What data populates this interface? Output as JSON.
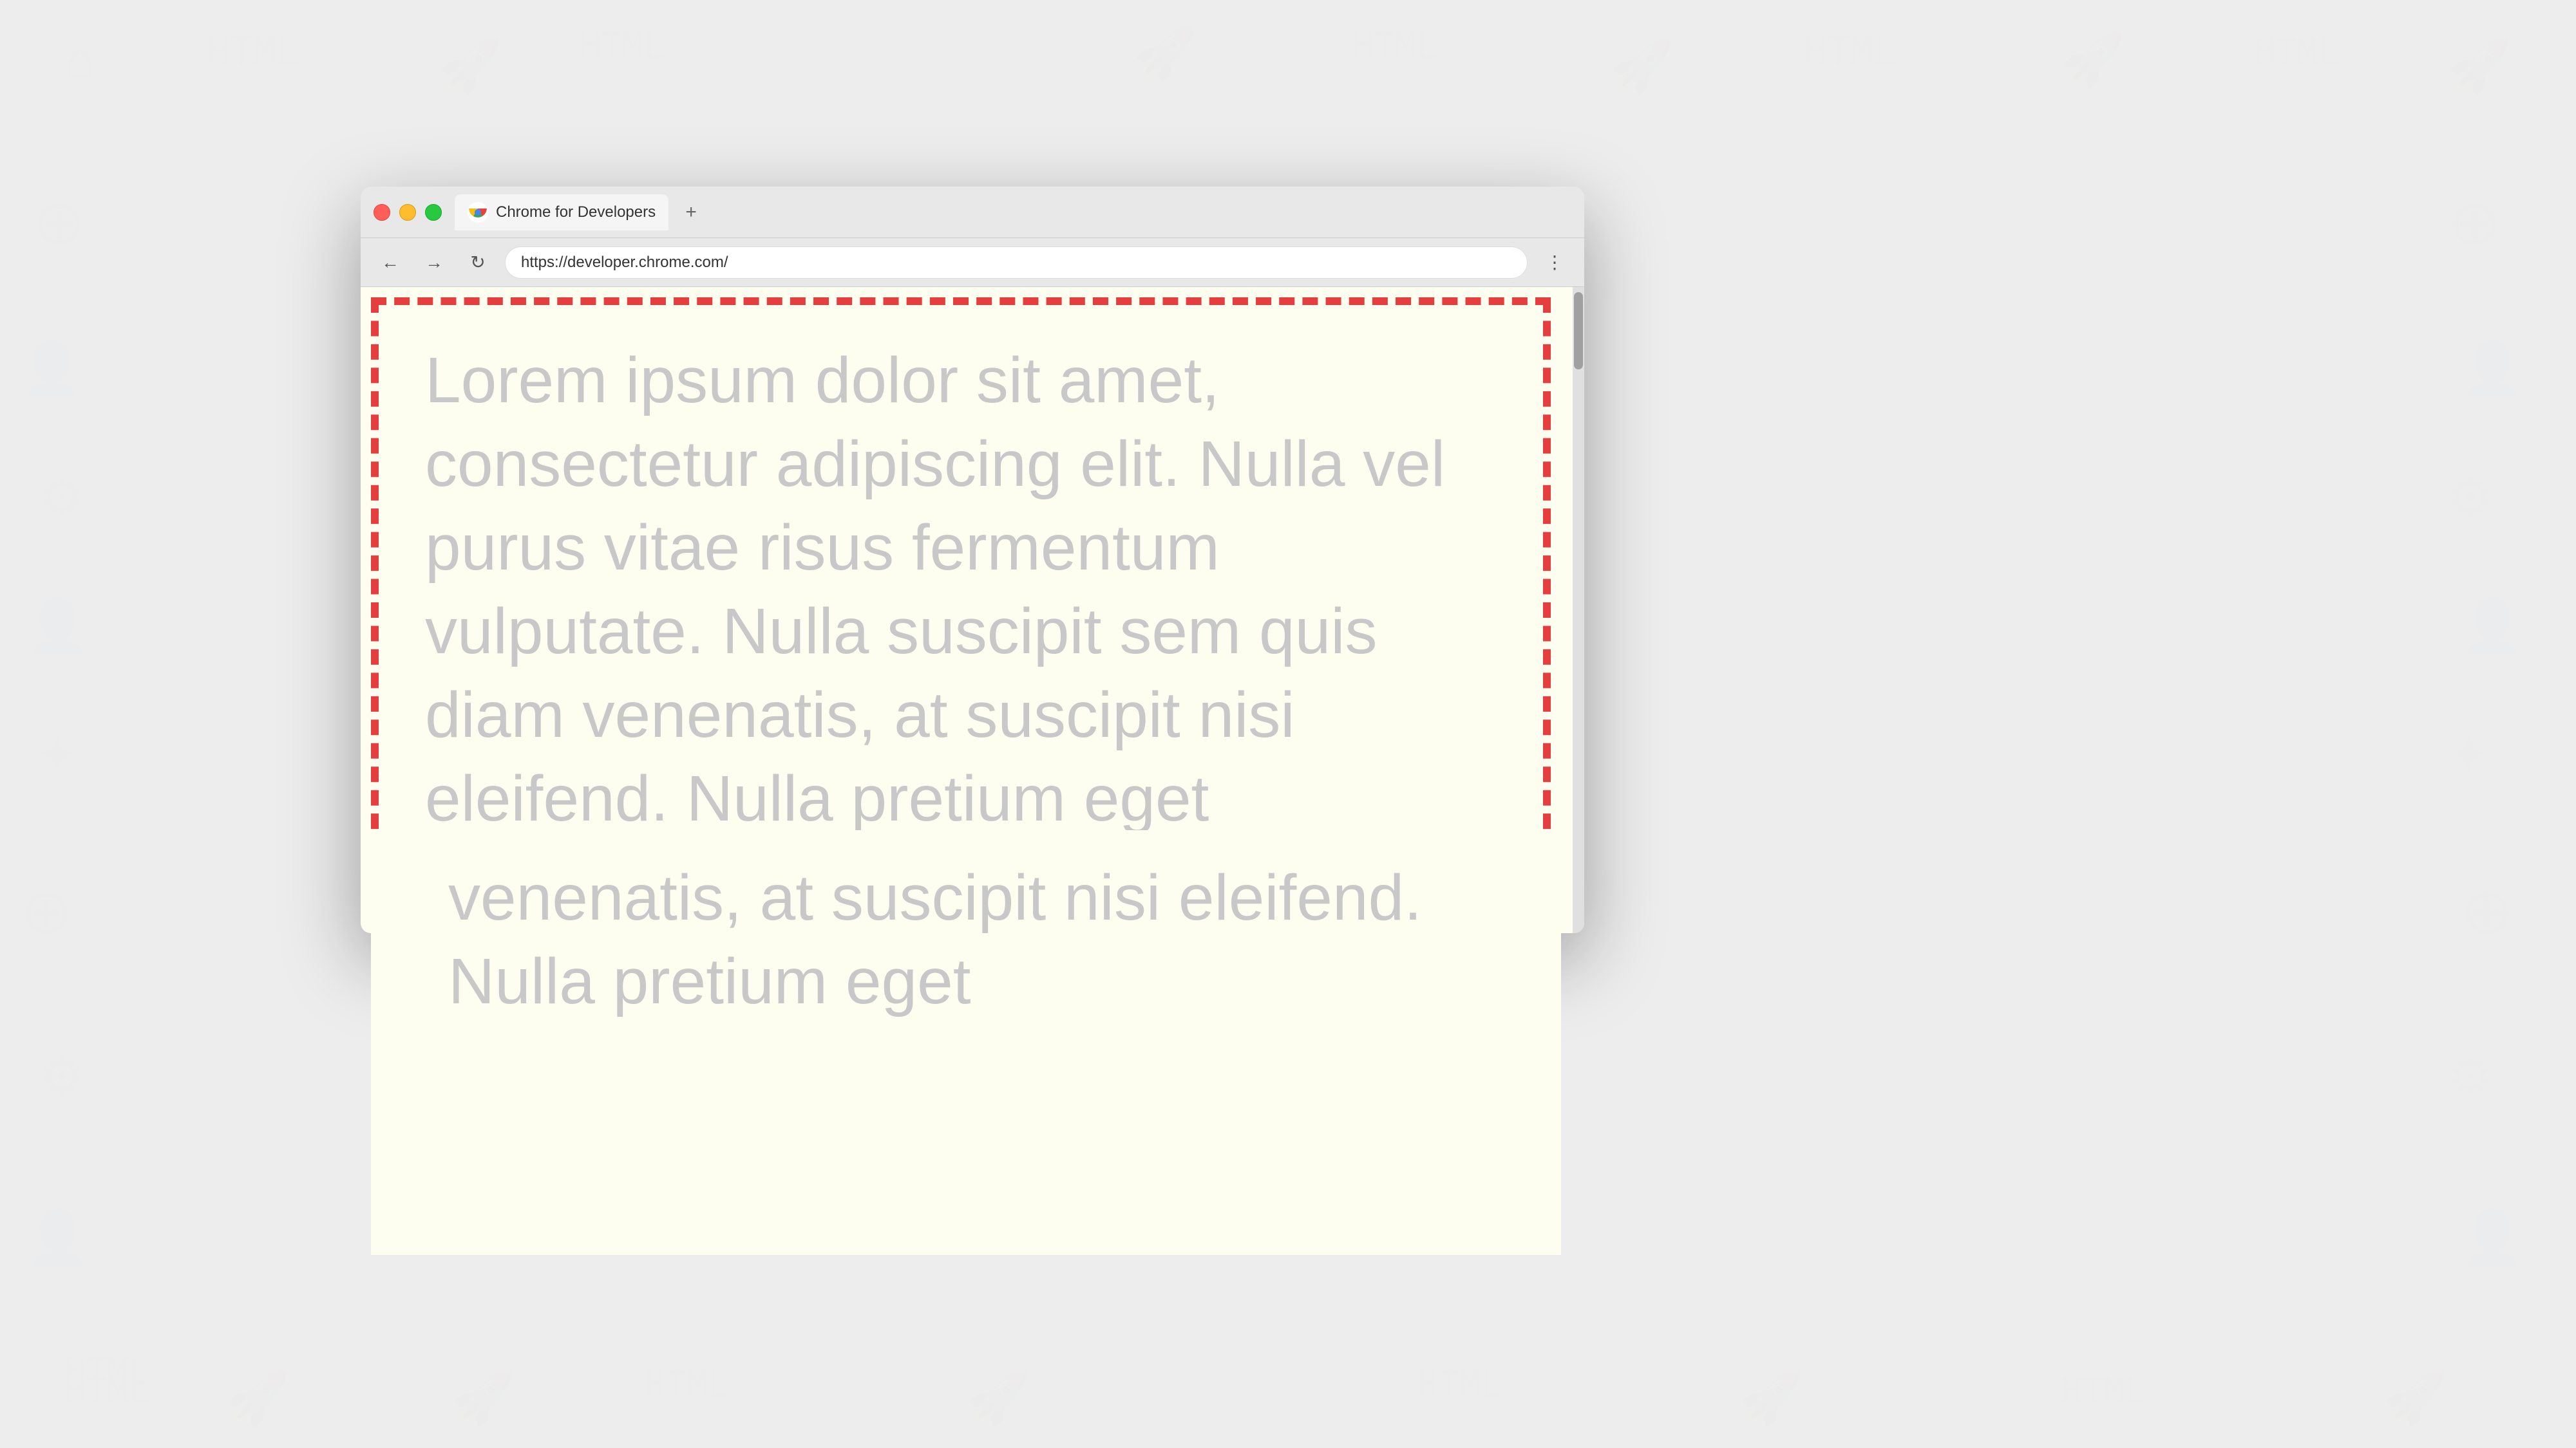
{
  "background": {
    "color": "#f0f0f0"
  },
  "browser": {
    "title_bar": {
      "traffic_lights": {
        "red": "#ff5f57",
        "yellow": "#febc2e",
        "green": "#28c840"
      },
      "tab": {
        "title": "Chrome for Developers",
        "favicon": "chrome-logo"
      },
      "new_tab_label": "+"
    },
    "nav_bar": {
      "back_label": "←",
      "forward_label": "→",
      "refresh_label": "↻",
      "url": "https://developer.chrome.com/",
      "menu_label": "⋮"
    },
    "content": {
      "lorem_text": "Lorem ipsum dolor sit amet, consectetur adipiscing elit. Nulla vel purus vitae risus fermentum vulputate. Nulla suscipit sem quis diam venenatis, at suscipit nisi eleifend. Nulla pretium eget",
      "below_fold_text": "venenatis, at suscipit nisi eleifend. Nulla pretium eget"
    }
  }
}
